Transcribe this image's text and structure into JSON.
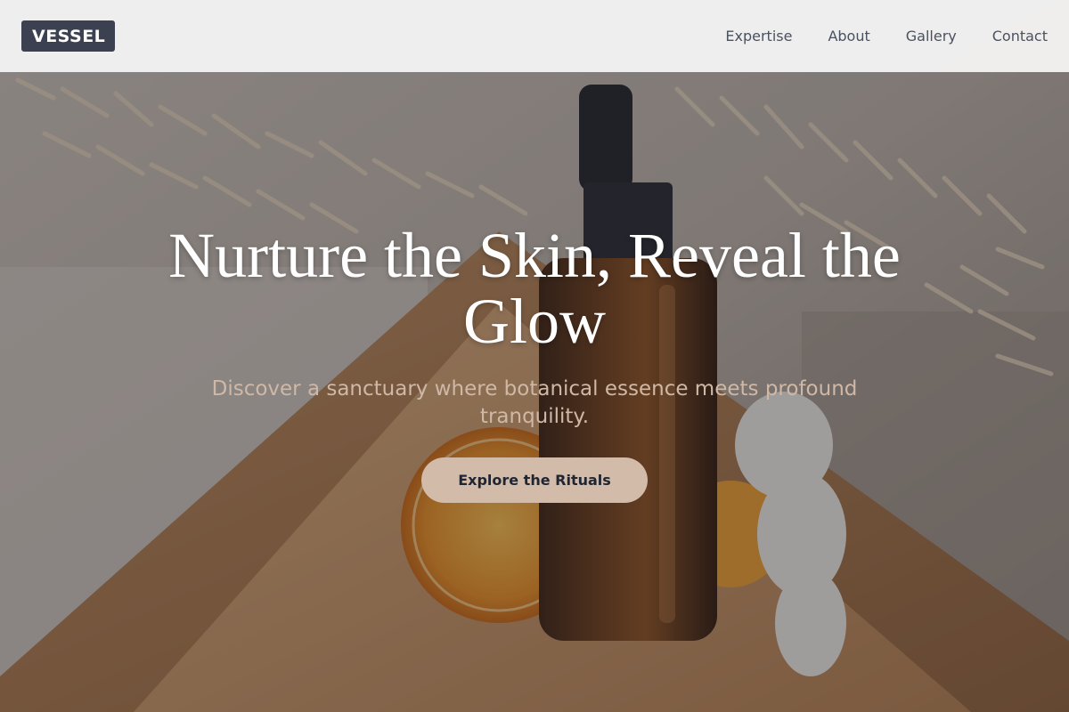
{
  "brand": {
    "logo": "VESSEL"
  },
  "nav": {
    "items": [
      {
        "label": "Expertise"
      },
      {
        "label": "About"
      },
      {
        "label": "Gallery"
      },
      {
        "label": "Contact"
      }
    ]
  },
  "hero": {
    "title": "Nurture the Skin, Reveal the Glow",
    "subtitle": "Discover a sanctuary where botanical essence meets profound tranquility.",
    "cta_label": "Explore the Rituals"
  },
  "colors": {
    "header_bg": "#f4f3f2",
    "logo_bg": "#3b4150",
    "nav_text": "#4a5160",
    "subtitle_text": "#cfb8a6",
    "cta_bg": "#d2bba9",
    "cta_text": "#1f2533"
  }
}
